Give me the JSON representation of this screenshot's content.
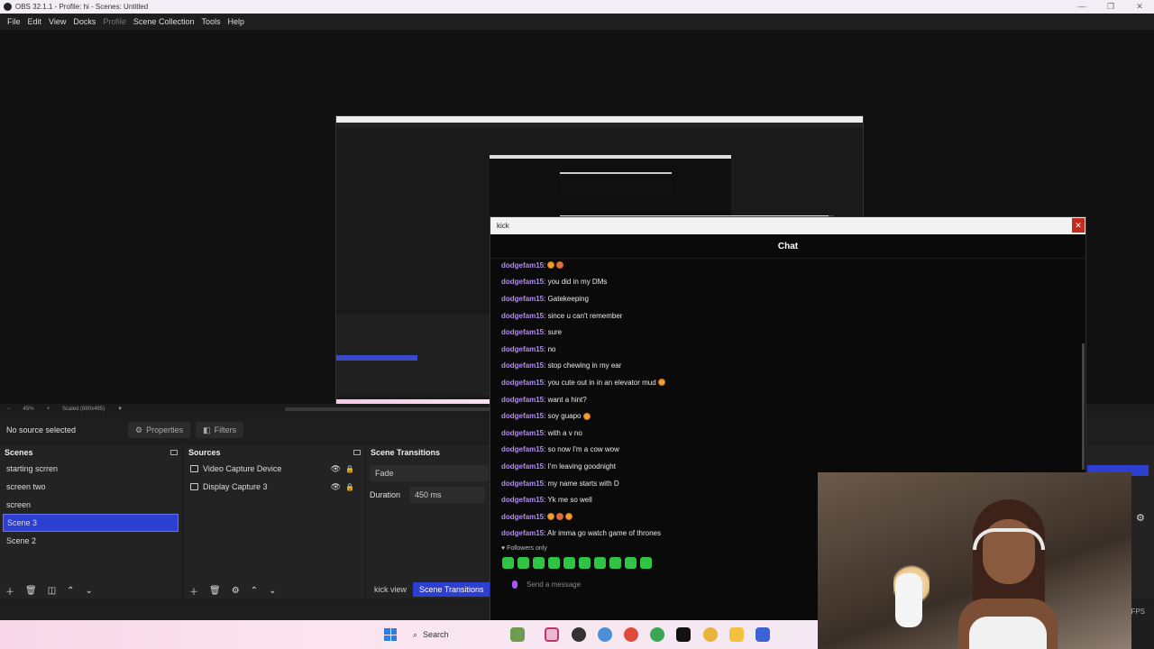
{
  "window": {
    "title": "OBS 32.1.1 - Profile: hi - Scenes: Untitled"
  },
  "menu": [
    "File",
    "Edit",
    "View",
    "Docks",
    "Profile",
    "Scene Collection",
    "Tools",
    "Help"
  ],
  "preview": {
    "zoom": "45%",
    "scale_label": "Scaled (880x495)"
  },
  "context": {
    "no_source": "No source selected",
    "properties": "Properties",
    "filters": "Filters"
  },
  "scenes": {
    "title": "Scenes",
    "items": [
      "starting scrren",
      "screen two",
      "screen",
      "Scene 3",
      "Scene 2"
    ],
    "selected": "Scene 3"
  },
  "sources": {
    "title": "Sources",
    "items": [
      {
        "label": "Video Capture Device",
        "icon": "camera-icon"
      },
      {
        "label": "Display Capture 3",
        "icon": "monitor-icon"
      }
    ]
  },
  "transitions": {
    "title": "Scene Transitions",
    "type": "Fade",
    "duration_label": "Duration",
    "duration": "450 ms"
  },
  "dock_tabs": {
    "kick_view": "kick view",
    "scene_transitions": "Scene Transitions"
  },
  "status": {
    "fps": "FPS"
  },
  "chat": {
    "window_title": "kick",
    "header": "Chat",
    "messages": [
      {
        "user": "dodgefam15",
        "text": ": ",
        "emotes": 2
      },
      {
        "user": "dodgefam15",
        "text": ": you did in my DMs"
      },
      {
        "user": "dodgefam15",
        "text": ": Gatekeeping"
      },
      {
        "user": "dodgefam15",
        "text": ": since u can't remember"
      },
      {
        "user": "dodgefam15",
        "text": ": sure"
      },
      {
        "user": "dodgefam15",
        "text": ": no"
      },
      {
        "user": "dodgefam15",
        "text": ": stop chewing in my ear"
      },
      {
        "user": "dodgefam15",
        "text": ": you cute out in in an elevator mud",
        "emotes": 1
      },
      {
        "user": "dodgefam15",
        "text": ": want a hint?"
      },
      {
        "user": "dodgefam15",
        "text": ": soy guapo",
        "emotes": 1
      },
      {
        "user": "dodgefam15",
        "text": ": with a v no"
      },
      {
        "user": "dodgefam15",
        "text": ": so now I'm a cow wow"
      },
      {
        "user": "dodgefam15",
        "text": ": I'm leaving goodnight"
      },
      {
        "user": "dodgefam15",
        "text": ": my name starts with D"
      },
      {
        "user": "dodgefam15",
        "text": ": Yk me so well"
      },
      {
        "user": "dodgefam15",
        "text": ": ",
        "emotes": 3
      },
      {
        "user": "dodgefam15",
        "text": ": Alr imma go watch game of thrones"
      }
    ],
    "followers_only": "Followers only",
    "send_placeholder": "Send a message"
  },
  "taskbar": {
    "search": "Search"
  },
  "colors": {
    "accent": "#2c3fd0",
    "chat_user": "#b18cf0",
    "close_red": "#c42b1c"
  }
}
